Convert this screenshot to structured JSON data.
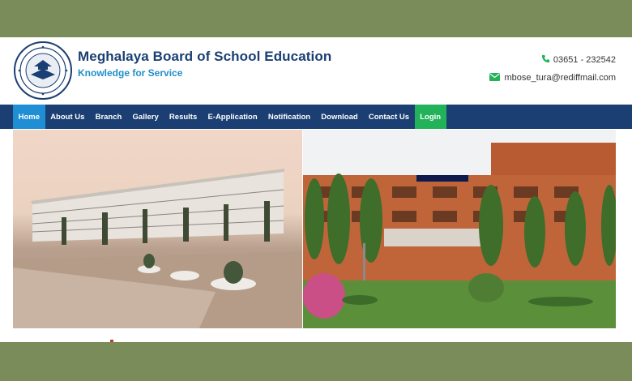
{
  "header": {
    "title": "Meghalaya Board of School Education",
    "tagline": "Knowledge for Service",
    "phone": "03651 - 232542",
    "email": "mbose_tura@rediffmail.com",
    "phone_icon": "phone-icon",
    "email_icon": "envelope-icon"
  },
  "nav": {
    "items": [
      {
        "label": "Home"
      },
      {
        "label": "About Us"
      },
      {
        "label": "Branch"
      },
      {
        "label": "Gallery"
      },
      {
        "label": "Results"
      },
      {
        "label": "E-Application"
      },
      {
        "label": "Notification"
      },
      {
        "label": "Download"
      },
      {
        "label": "Contact Us"
      },
      {
        "label": "Login"
      }
    ]
  },
  "photos": {
    "left_alt": "Historic sepia photo of board building",
    "right_alt": "Current board building with garden"
  },
  "colors": {
    "brand_navy": "#1b3f73",
    "brand_blue": "#1f8ed4",
    "brand_green": "#22b35a",
    "frame_olive": "#7a8c5a"
  }
}
